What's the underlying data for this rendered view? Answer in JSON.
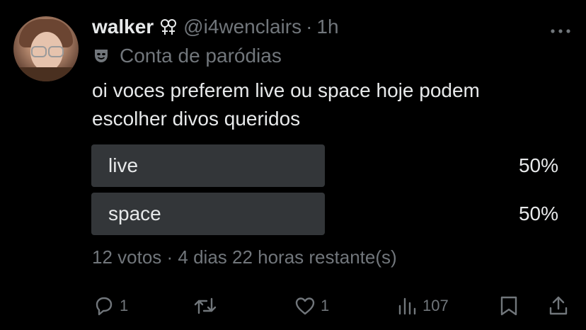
{
  "author": {
    "name": "walker",
    "handle": "@i4wenclairs",
    "separator": "·",
    "time": "1h",
    "badge_icon": "doubled-female-sign-icon",
    "parody_label": "Conta de paródias",
    "parody_icon": "theater-mask-icon"
  },
  "tweet": {
    "text_lines": [
      "oi voces preferem live ou space hoje podem",
      "escolher divos queridos"
    ]
  },
  "poll": {
    "options": [
      {
        "label": "live",
        "percent_text": "50%",
        "fill_fraction": 0.5
      },
      {
        "label": "space",
        "percent_text": "50%",
        "fill_fraction": 0.5
      }
    ],
    "meta": "12 votos · 4 dias 22 horas restante(s)"
  },
  "actions": {
    "reply_count": "1",
    "retweet_count": "",
    "like_count": "1",
    "views_count": "107"
  },
  "colors": {
    "background": "#000000",
    "primary_text": "#e7e9ea",
    "secondary_text": "#71767b",
    "poll_bar": "#333639"
  },
  "icons": {
    "more": "more-horizontal-icon",
    "reply": "reply-bubble-icon",
    "retweet": "retweet-icon",
    "like": "heart-icon",
    "views": "views-bars-icon",
    "bookmark": "bookmark-icon",
    "share": "share-upload-icon"
  }
}
